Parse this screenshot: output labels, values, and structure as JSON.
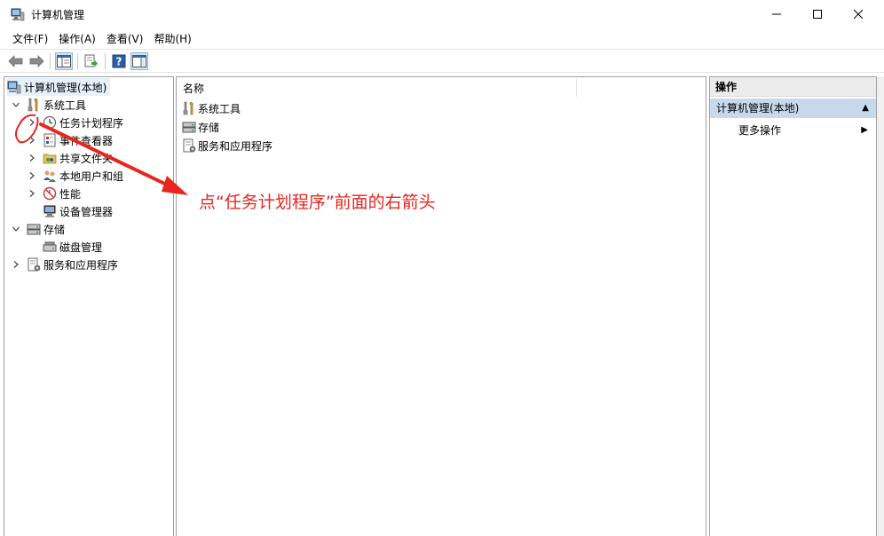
{
  "window": {
    "title": "计算机管理",
    "controls": {
      "minimize": "—",
      "maximize": "☐",
      "close": "✕"
    }
  },
  "menu": [
    "文件(F)",
    "操作(A)",
    "查看(V)",
    "帮助(H)"
  ],
  "tree": {
    "root": "计算机管理(本地)",
    "system_tools": "系统工具",
    "task_scheduler": "任务计划程序",
    "event_viewer": "事件查看器",
    "shared_folders": "共享文件夹",
    "local_users": "本地用户和组",
    "performance": "性能",
    "device_manager": "设备管理器",
    "storage": "存储",
    "disk_management": "磁盘管理",
    "services_apps": "服务和应用程序"
  },
  "middle": {
    "column_name": "名称",
    "items": [
      "系统工具",
      "存储",
      "服务和应用程序"
    ]
  },
  "actions": {
    "header": "操作",
    "section": "计算机管理(本地)",
    "more": "更多操作"
  },
  "annotation": {
    "text": "点“任务计划程序”前面的右箭头",
    "color": "#e8251f"
  }
}
